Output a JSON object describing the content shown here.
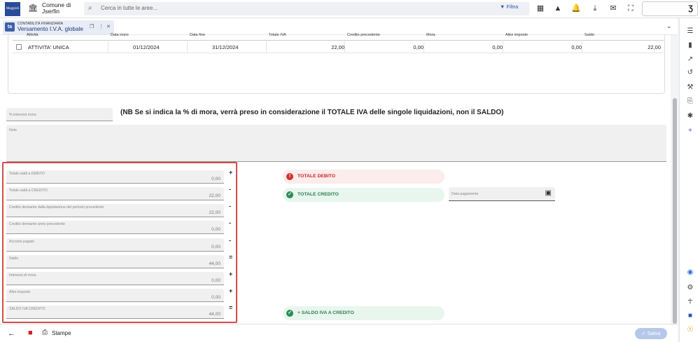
{
  "header": {
    "logo_text": "Maggioli",
    "comune_line1": "Comune di",
    "comune_line2": "Jserfin",
    "search_placeholder": "Cerca in tutte le aree...",
    "filter_label": "Filtra",
    "user_initial": "Ʒ"
  },
  "tab": {
    "badge": "ta",
    "category": "CONTABILITÀ FINANZIARIA",
    "title": "Versamento I.V.A. globale"
  },
  "table": {
    "headers": [
      "Attività",
      "Data inizio",
      "Data fine",
      "Totale IVA",
      "Credito precedente",
      "Mora",
      "Altre imposte",
      "Saldo"
    ],
    "rows": [
      {
        "attivita": "ATTIVITA' UNICA",
        "data_inizio": "01/12/2024",
        "data_fine": "31/12/2024",
        "totale_iva": "22,00",
        "credito_precedente": "0,00",
        "mora": "0,00",
        "altre_imposte": "0,00",
        "saldo": "22,00"
      }
    ]
  },
  "form": {
    "interessi_mora_label": "% interessi mora",
    "nb_text": "(NB Se si indica la % di mora, verrà preso in considerazione il TOTALE IVA delle singole liquidazioni, non il SALDO)",
    "note_label": "Note"
  },
  "totals": [
    {
      "label": "Totale saldi a DEBITO",
      "value": "0,00",
      "op": "+"
    },
    {
      "label": "Totale saldi a CREDITO",
      "value": "22,00",
      "op": "-"
    },
    {
      "label": "Credito derivante dalla liquidazione del periodo precedente",
      "value": "22,00",
      "op": "-"
    },
    {
      "label": "Credito derivante anno precedente",
      "value": "0,00",
      "op": "-"
    },
    {
      "label": "Acconto pagato",
      "value": "0,00",
      "op": "-"
    },
    {
      "label": "Saldo",
      "value": "44,00",
      "op": "="
    },
    {
      "label": "Interessi di mora",
      "value": "0,00",
      "op": "+"
    },
    {
      "label": "Altre imposte",
      "value": "0,00",
      "op": "+"
    },
    {
      "label": "SALDO IVA CREDITO",
      "value": "44,00",
      "op": "="
    }
  ],
  "status": {
    "totale_debito": "TOTALE DEBITO",
    "totale_credito": "TOTALE CREDITO",
    "saldo_credito": "+ SALDO IVA A CREDITO",
    "data_pagamento_label": "Data pagamento",
    "colors": {
      "debito": "#d32f2f",
      "credito": "#2e8b57"
    }
  },
  "bottom": {
    "print_label": "Stampe",
    "save_label": "Salva"
  }
}
